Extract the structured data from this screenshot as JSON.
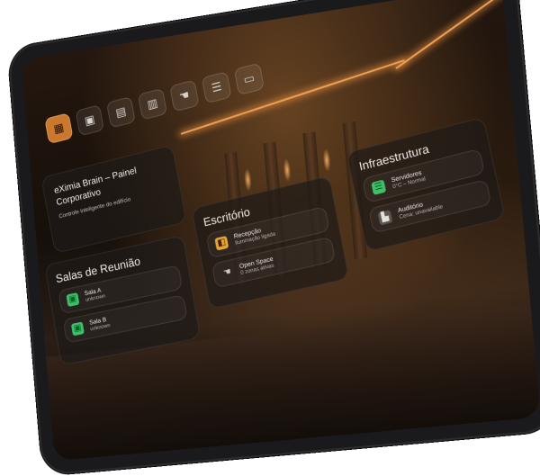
{
  "toolbar": {
    "items": [
      {
        "name": "dashboard",
        "icon": "grid-icon",
        "glyph": "▦",
        "active": true
      },
      {
        "name": "rooms",
        "icon": "door-icon",
        "glyph": "▣",
        "active": false
      },
      {
        "name": "calendar",
        "icon": "calendar-icon",
        "glyph": "▤",
        "active": false
      },
      {
        "name": "schedule",
        "icon": "schedule-icon",
        "glyph": "▥",
        "active": false
      },
      {
        "name": "lighting",
        "icon": "hand-icon",
        "glyph": "☚",
        "active": false
      },
      {
        "name": "infrastructure",
        "icon": "server-icon",
        "glyph": "☰",
        "active": false
      },
      {
        "name": "monitor",
        "icon": "monitor-icon",
        "glyph": "▭",
        "active": false
      }
    ]
  },
  "brand": {
    "title": "eXimia Brain – Painel Corporativo",
    "subtitle": "Controle inteligente do edifício"
  },
  "meeting_rooms": {
    "title": "Salas de Reunião",
    "items": [
      {
        "name": "Sala A",
        "status": "unknown",
        "icon": "door-icon",
        "glyph": "▣"
      },
      {
        "name": "Sala B",
        "status": "unknown",
        "icon": "door-icon",
        "glyph": "▣"
      }
    ]
  },
  "office": {
    "title": "Escritório",
    "items": [
      {
        "name": "Recepção",
        "status": "Iluminação ligada",
        "icon": "lamp-icon",
        "glyph": "◧"
      },
      {
        "name": "Open Space",
        "status": "0 zonas ativas",
        "icon": "hand-icon",
        "glyph": "☚"
      }
    ]
  },
  "infrastructure": {
    "title": "Infraestrutura",
    "items": [
      {
        "name": "Servidores",
        "status": "0°C – Normal",
        "icon": "server-icon",
        "glyph": "☰"
      },
      {
        "name": "Auditório",
        "status": "Cena: unavailable",
        "icon": "auditorium-icon",
        "glyph": "▙"
      }
    ]
  },
  "colors": {
    "accent": "#c9782e",
    "green": "#3fbf6a",
    "amber": "#e8a23a",
    "gray": "#9a948e"
  }
}
